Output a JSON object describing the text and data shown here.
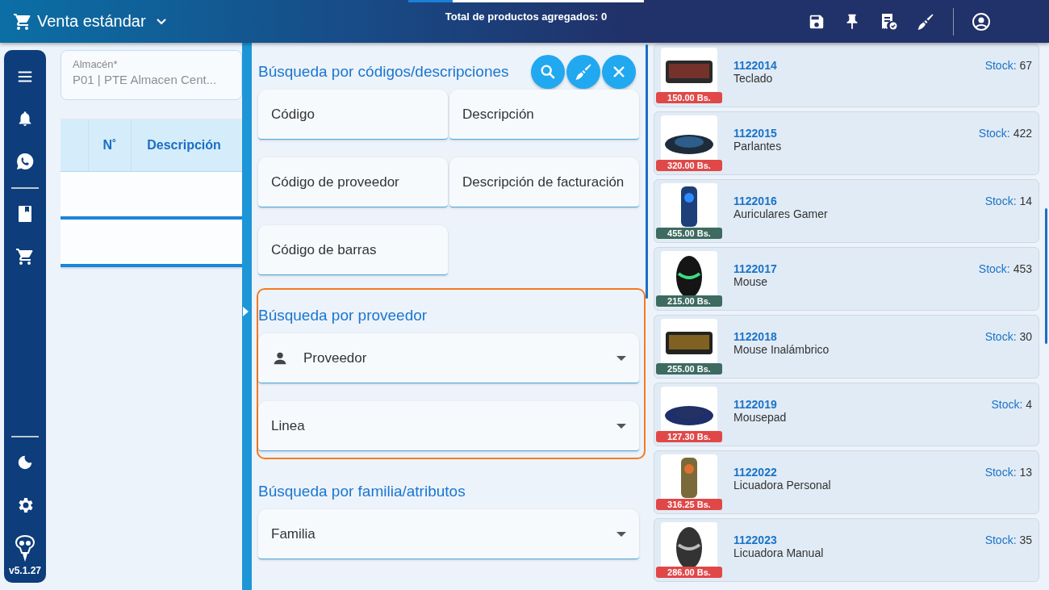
{
  "topbar": {
    "title": "Venta estándar",
    "total": "Total de productos agregados: 0",
    "progress": {
      "level": 0.19
    }
  },
  "sidebar": {
    "version": "v5.1.27"
  },
  "warehouse": {
    "label": "Almacén*",
    "value": "P01 | PTE Almacen Cent..."
  },
  "table": {
    "columns": [
      "N˚",
      "Descripción"
    ]
  },
  "search_panel": {
    "sections": [
      {
        "title": "Búsqueda por códigos/descripciones",
        "highlighted": false,
        "actions": true,
        "fields": [
          {
            "placeholder": "Código",
            "kind": "text"
          },
          {
            "placeholder": "Descripción",
            "kind": "text"
          },
          {
            "placeholder": "Código de proveedor",
            "kind": "text"
          },
          {
            "placeholder": "Descripción de facturación",
            "kind": "text"
          },
          {
            "placeholder": "Código de barras",
            "kind": "text"
          }
        ]
      },
      {
        "title": "Búsqueda por proveedor",
        "highlighted": true,
        "actions": false,
        "fields": [
          {
            "label": "Proveedor",
            "kind": "person"
          },
          {
            "label": "Linea",
            "kind": "select"
          }
        ]
      },
      {
        "title": "Búsqueda por familia/atributos",
        "highlighted": false,
        "actions": false,
        "fields": [
          {
            "label": "Familia",
            "kind": "select"
          }
        ]
      }
    ]
  },
  "products": [
    {
      "code": "1122014",
      "name": "Teclado",
      "stock_label": "Stock:",
      "stock": "67",
      "price": "150.00 Bs.",
      "color": "#e04848"
    },
    {
      "code": "1122015",
      "name": "Parlantes",
      "stock_label": "Stock:",
      "stock": "422",
      "price": "320.00 Bs.",
      "color": "#e04848"
    },
    {
      "code": "1122016",
      "name": "Auriculares Gamer",
      "stock_label": "Stock:",
      "stock": "14",
      "price": "455.00 Bs.",
      "color": "#3d6b5f"
    },
    {
      "code": "1122017",
      "name": "Mouse",
      "stock_label": "Stock:",
      "stock": "453",
      "price": "215.00 Bs.",
      "color": "#3d6b5f"
    },
    {
      "code": "1122018",
      "name": "Mouse Inalámbrico",
      "stock_label": "Stock:",
      "stock": "30",
      "price": "255.00 Bs.",
      "color": "#3d6b5f"
    },
    {
      "code": "1122019",
      "name": "Mousepad",
      "stock_label": "Stock:",
      "stock": "4",
      "price": "127.30 Bs.",
      "color": "#e04848"
    },
    {
      "code": "1122022",
      "name": "Licuadora Personal",
      "stock_label": "Stock:",
      "stock": "13",
      "price": "316.25 Bs.",
      "color": "#e04848"
    },
    {
      "code": "1122023",
      "name": "Licuadora Manual",
      "stock_label": "Stock:",
      "stock": "35",
      "price": "286.00 Bs.",
      "color": "#e04848"
    }
  ]
}
